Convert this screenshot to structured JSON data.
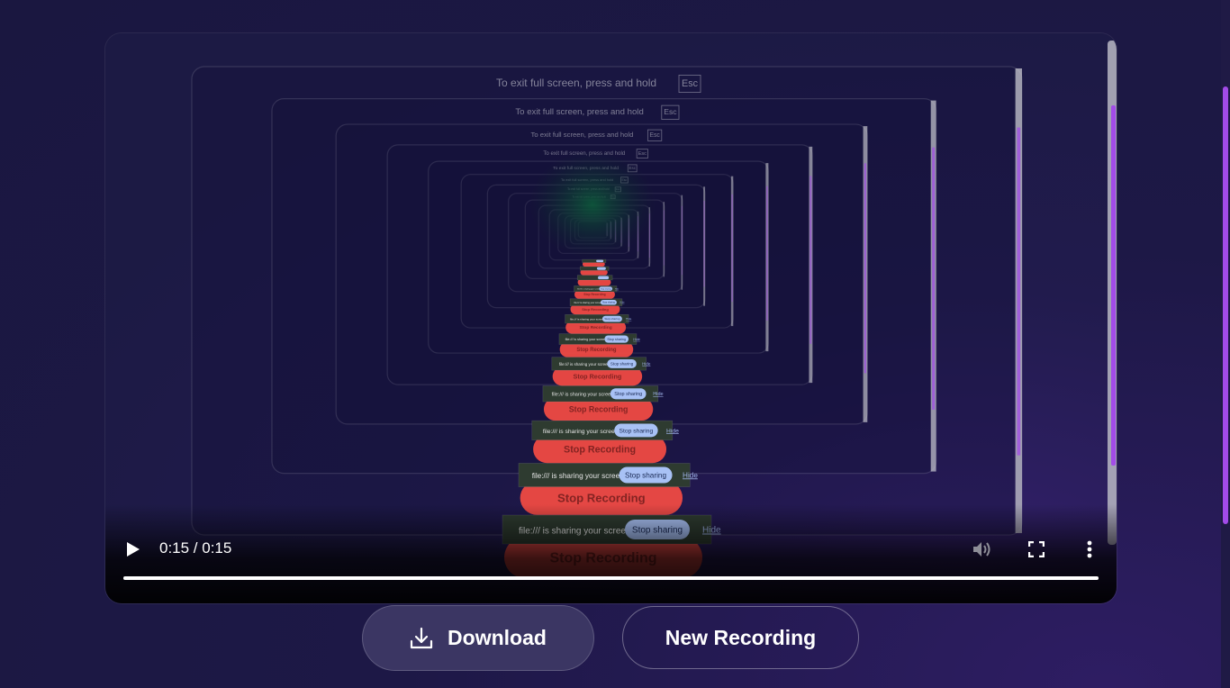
{
  "player": {
    "time": "0:15 / 0:15",
    "progress": 1.0,
    "recorded_overlay": {
      "exit_fullscreen_text": "To exit full screen, press and hold",
      "exit_key": "Esc",
      "sharing_text": "file:/// is sharing your screen.",
      "stop_sharing_label": "Stop sharing",
      "hide_label": "Hide",
      "stop_recording_label": "Stop Recording"
    }
  },
  "actions": {
    "download_label": "Download",
    "new_recording_label": "New Recording"
  },
  "colors": {
    "background": "#1b1740",
    "accent_purple": "#a24be8",
    "stop_recording_red": "#ef4a43",
    "stop_sharing_blue": "#a8c1f5",
    "download_bg": "#3b3663"
  },
  "icons": {
    "play": "play-icon",
    "volume": "volume-icon",
    "fullscreen": "fullscreen-icon",
    "more": "more-vertical-icon",
    "download": "download-icon"
  }
}
